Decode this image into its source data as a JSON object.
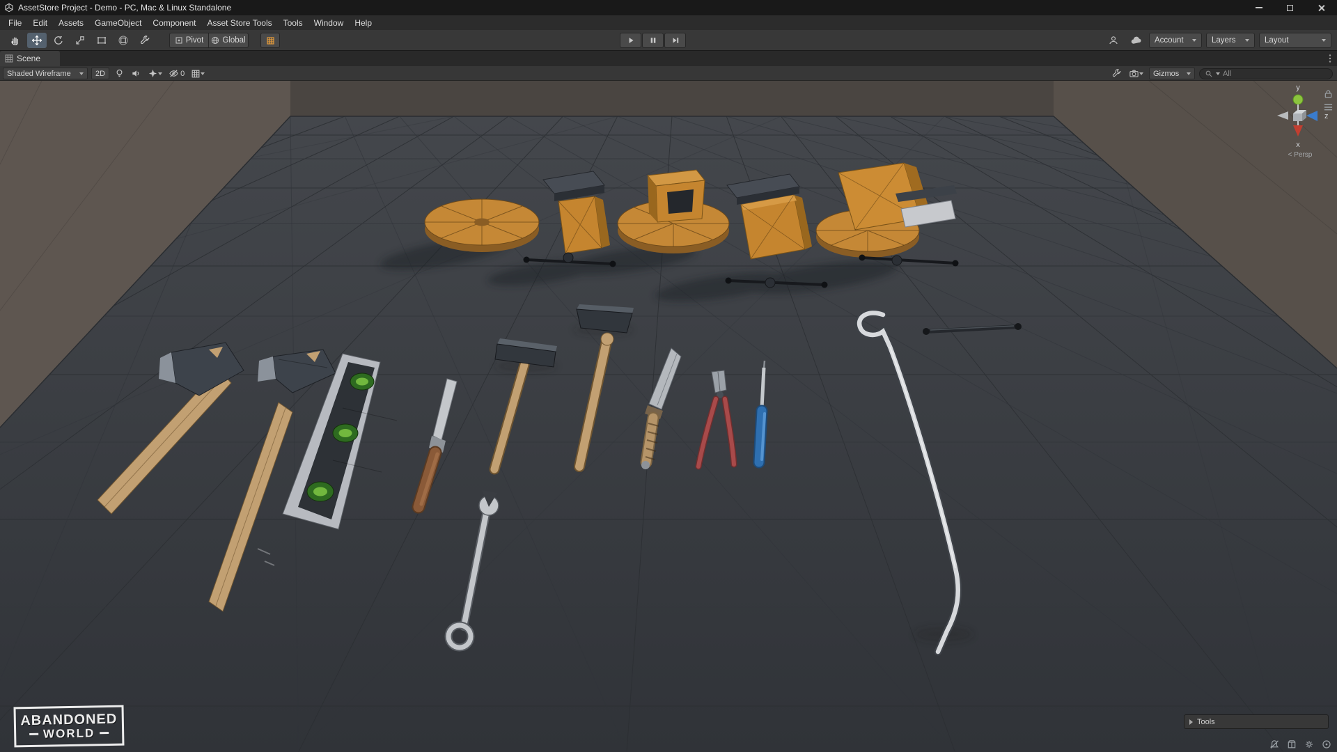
{
  "window": {
    "title": "AssetStore Project - Demo - PC, Mac & Linux Standalone"
  },
  "menu_bar": {
    "items": [
      "File",
      "Edit",
      "Assets",
      "GameObject",
      "Component",
      "Asset Store Tools",
      "Tools",
      "Window",
      "Help"
    ]
  },
  "toolbar": {
    "pivot_label": "Pivot",
    "global_label": "Global",
    "account_label": "Account",
    "layers_label": "Layers",
    "layout_label": "Layout"
  },
  "scene_panel": {
    "tab_label": "Scene",
    "draw_mode_label": "Shaded Wireframe",
    "mode_2d_label": "2D",
    "hidden_count": "0",
    "gizmos_label": "Gizmos",
    "search_text": "All"
  },
  "viewport": {
    "axis_y": "y",
    "axis_x": "x",
    "axis_z": "z",
    "projection_label": "< Persp",
    "tools_overlay_label": "Tools",
    "watermark": {
      "line1": "ABANDONED",
      "line2": "WORLD"
    },
    "models": [
      "grinding wheel",
      "bench vise",
      "grinding wheel with stand",
      "bench vise",
      "large bench vise with wheel base",
      "axe",
      "axe head",
      "axe handle",
      "spirit level",
      "chisel",
      "hammer",
      "mallet head",
      "mallet handle",
      "knife",
      "pliers",
      "screwdriver",
      "crowbar",
      "steel pipe",
      "wrench"
    ]
  },
  "colors": {
    "accent_orange": "#c5852f",
    "vial_green": "#72b83e",
    "handle_blue": "#2e6fb0",
    "plier_red": "#a84a4a",
    "selected_tool_bg": "#54616e"
  }
}
